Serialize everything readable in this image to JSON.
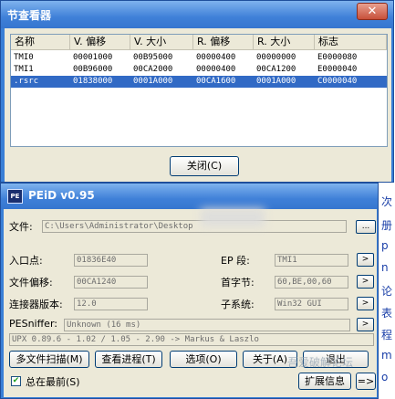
{
  "section_viewer": {
    "title": "节查看器",
    "close_x": "✕",
    "columns": [
      "名称",
      "V. 偏移",
      "V. 大小",
      "R. 偏移",
      "R. 大小",
      "标志"
    ],
    "rows": [
      {
        "name": "TMI0",
        "voffset": "00001000",
        "vsize": "00B95000",
        "roffset": "00000400",
        "rsize": "00000000",
        "flags": "E0000080",
        "selected": false
      },
      {
        "name": "TMI1",
        "voffset": "00B96000",
        "vsize": "00CA2000",
        "roffset": "00000400",
        "rsize": "00CA1200",
        "flags": "E0000040",
        "selected": false
      },
      {
        "name": ".rsrc",
        "voffset": "01838000",
        "vsize": "0001A000",
        "roffset": "00CA1600",
        "rsize": "0001A000",
        "flags": "C0000040",
        "selected": true
      }
    ],
    "close_button": "关闭(C)"
  },
  "peid": {
    "title": "PEiD v0.95",
    "logo": "PE",
    "file_label": "文件:",
    "file_path": "C:\\Users\\Administrator\\Desktop",
    "browse": "...",
    "entry_point_label": "入口点:",
    "entry_point": "01836E40",
    "ep_section_label": "EP 段:",
    "ep_section": "TMI1",
    "file_offset_label": "文件偏移:",
    "file_offset": "00CA1240",
    "first_bytes_label": "首字节:",
    "first_bytes": "60,BE,00,60",
    "linker_label": "连接器版本:",
    "linker": "12.0",
    "subsystem_label": "子系统:",
    "subsystem": "Win32 GUI",
    "pesniffer_label": "PESniffer:",
    "pesniffer": "Unknown (16 ms)",
    "detection": "UPX 0.89.6 - 1.02 / 1.05 - 2.90 -> Markus & Laszlo",
    "arrow": ">",
    "buttons": {
      "multi_scan": "多文件扫描(M)",
      "task_viewer": "查看进程(T)",
      "options": "选项(O)",
      "about": "关于(A)",
      "exit": "退出"
    },
    "stay_on_top": "总在最前(S)",
    "extra": "扩展信息",
    "extra_arrow": "=>"
  },
  "background": {
    "strip_glyphs": [
      "次",
      "册",
      "p",
      "n",
      "论",
      "表",
      "程",
      "m",
      "o"
    ],
    "watermark": "吾爱破解论坛"
  }
}
